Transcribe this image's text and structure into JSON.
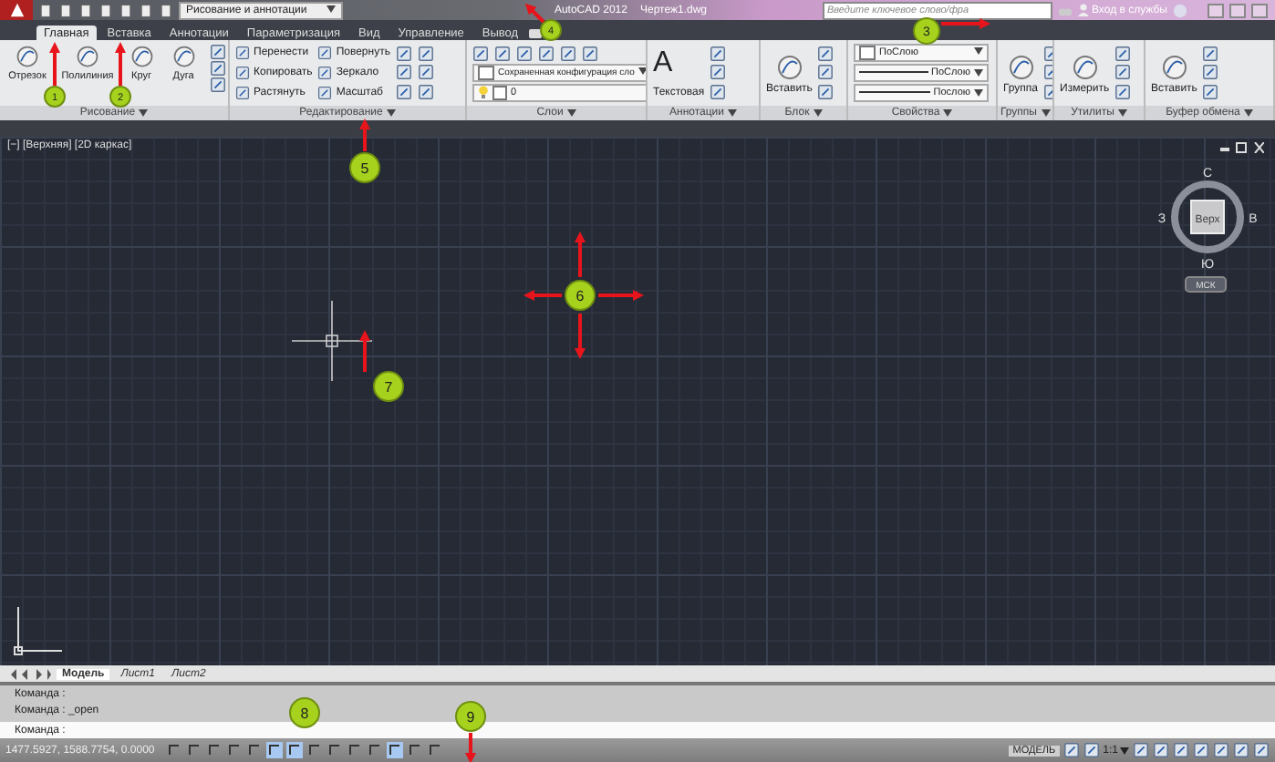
{
  "title_bar": {
    "workspace": "Рисование и аннотации",
    "app_title": "AutoCAD 2012",
    "file_name": "Чертеж1.dwg",
    "search_placeholder": "Введите ключевое слово/фра",
    "login": "Вход в службы"
  },
  "tabs": [
    {
      "label": "Главная",
      "selected": true
    },
    {
      "label": "Вставка",
      "selected": false
    },
    {
      "label": "Аннотации",
      "selected": false
    },
    {
      "label": "Параметризация",
      "selected": false
    },
    {
      "label": "Вид",
      "selected": false
    },
    {
      "label": "Управление",
      "selected": false
    },
    {
      "label": "Вывод",
      "selected": false
    }
  ],
  "panels": [
    {
      "title": "Рисование",
      "columns": [
        [
          {
            "kind": "big",
            "label": "Отрезок"
          }
        ],
        [
          {
            "kind": "big",
            "label": "Полилиния"
          }
        ],
        [
          {
            "kind": "big",
            "label": "Круг"
          }
        ],
        [
          {
            "kind": "big",
            "label": "Дуга"
          }
        ],
        [
          {
            "kind": "icon"
          },
          {
            "kind": "icon"
          },
          {
            "kind": "icon"
          }
        ]
      ]
    },
    {
      "title": "Редактирование",
      "columns": [
        [
          {
            "kind": "small",
            "label": "Перенести"
          },
          {
            "kind": "small",
            "label": "Копировать"
          },
          {
            "kind": "small",
            "label": "Растянуть"
          }
        ],
        [
          {
            "kind": "small",
            "label": "Повернуть"
          },
          {
            "kind": "small",
            "label": "Зеркало"
          },
          {
            "kind": "small",
            "label": "Масштаб"
          }
        ],
        [
          {
            "kind": "icon"
          },
          {
            "kind": "icon"
          },
          {
            "kind": "icon"
          }
        ],
        [
          {
            "kind": "icon"
          },
          {
            "kind": "icon"
          },
          {
            "kind": "icon"
          }
        ]
      ]
    },
    {
      "title": "Слои",
      "columns": [
        [
          {
            "kind": "icons"
          },
          {
            "kind": "field",
            "label": "Сохраненная конфигурация сло"
          },
          {
            "kind": "layer",
            "label": "0"
          }
        ]
      ]
    },
    {
      "title": "Аннотации",
      "columns": [
        [
          {
            "kind": "letter",
            "label": "A"
          },
          {
            "kind": "label",
            "label": "Текстовая"
          }
        ],
        [
          {
            "kind": "icon"
          },
          {
            "kind": "icon"
          },
          {
            "kind": "icon"
          }
        ]
      ]
    },
    {
      "title": "Блок",
      "columns": [
        [
          {
            "kind": "big",
            "label": "Вставить"
          }
        ],
        [
          {
            "kind": "icon"
          },
          {
            "kind": "icon"
          },
          {
            "kind": "icon"
          }
        ]
      ]
    },
    {
      "title": "Свойства",
      "columns": [
        [
          {
            "kind": "field",
            "label": "ПоСлою"
          },
          {
            "kind": "line",
            "label": "ПоСлою"
          },
          {
            "kind": "line",
            "label": "Послою"
          }
        ]
      ]
    },
    {
      "title": "Группы",
      "columns": [
        [
          {
            "kind": "big",
            "label": "Группа"
          }
        ],
        [
          {
            "kind": "icon"
          },
          {
            "kind": "icon"
          },
          {
            "kind": "icon"
          }
        ]
      ]
    },
    {
      "title": "Утилиты",
      "columns": [
        [
          {
            "kind": "big",
            "label": "Измерить"
          }
        ],
        [
          {
            "kind": "icon"
          },
          {
            "kind": "icon"
          },
          {
            "kind": "icon"
          }
        ]
      ]
    },
    {
      "title": "Буфер обмена",
      "columns": [
        [
          {
            "kind": "big",
            "label": "Вставить"
          }
        ],
        [
          {
            "kind": "icon"
          },
          {
            "kind": "icon"
          },
          {
            "kind": "icon"
          }
        ]
      ]
    }
  ],
  "viewport": {
    "label": "[−] [Верхняя] [2D каркас]",
    "viewcube": {
      "north": "С",
      "west": "З",
      "east": "В",
      "south": "Ю",
      "face": "Верх",
      "ucs": "МСК"
    }
  },
  "layout_tabs": [
    {
      "label": "Модель",
      "selected": true
    },
    {
      "label": "Лист1",
      "selected": false
    },
    {
      "label": "Лист2",
      "selected": false
    }
  ],
  "command_history": [
    "Команда :",
    "Команда :  _open"
  ],
  "command_prompt": "Команда :",
  "status_bar": {
    "coordinates": "1477.5927, 1588.7754, 0.0000",
    "toggles": [
      {
        "on": false
      },
      {
        "on": false
      },
      {
        "on": false
      },
      {
        "on": false
      },
      {
        "on": false
      },
      {
        "on": true
      },
      {
        "on": true
      },
      {
        "on": false
      },
      {
        "on": false
      },
      {
        "on": false
      },
      {
        "on": false
      },
      {
        "on": true
      },
      {
        "on": false
      },
      {
        "on": false
      }
    ],
    "space": "МОДЕЛЬ",
    "scale": "1:1"
  },
  "callouts": [
    {
      "label": "1"
    },
    {
      "label": "2"
    },
    {
      "label": "3"
    },
    {
      "label": "4"
    },
    {
      "label": "5"
    },
    {
      "label": "6"
    },
    {
      "label": "7"
    },
    {
      "label": "8"
    },
    {
      "label": "9"
    }
  ]
}
